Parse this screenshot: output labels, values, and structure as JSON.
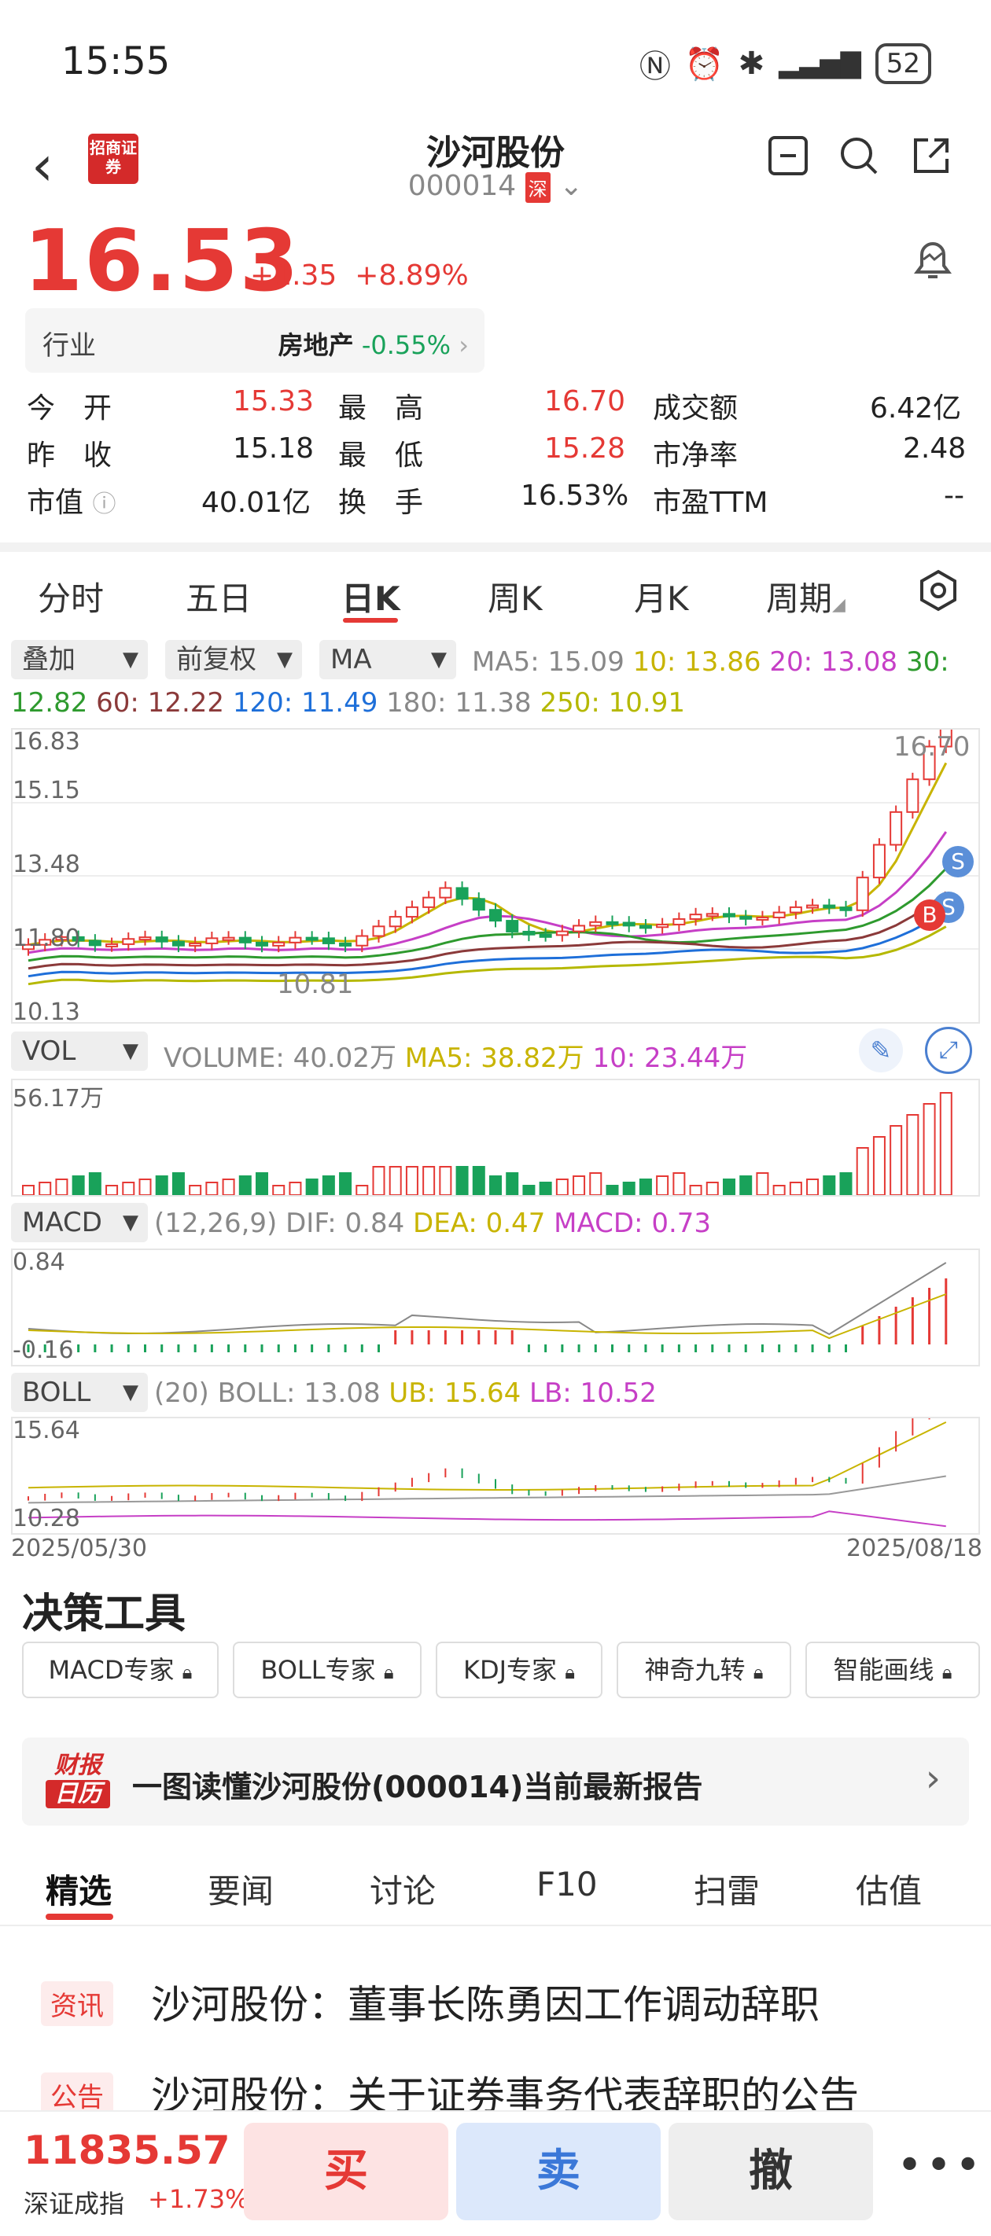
{
  "status_bar": {
    "time": "15:55",
    "battery": "52",
    "icons": [
      "nfc-icon",
      "alarm-icon",
      "bluetooth-icon",
      "signal-icon",
      "battery-icon"
    ]
  },
  "header": {
    "stock_name": "沙河股份",
    "stock_code": "000014",
    "market_tag": "深",
    "logo_text": "招商证券"
  },
  "quote": {
    "price": "16.53",
    "change": "+1.35",
    "change_pct": "+8.89%",
    "industry_label": "行业",
    "industry_name": "房地产",
    "industry_change": "-0.55%",
    "open_label": "今　开",
    "open": "15.33",
    "high_label": "最　高",
    "high": "16.70",
    "amount_label": "成交额",
    "amount": "6.42亿",
    "prev_close_label": "昨　收",
    "prev_close": "15.18",
    "low_label": "最　低",
    "low": "15.28",
    "pb_label": "市净率",
    "pb": "2.48",
    "mktcap_label": "市值",
    "mktcap": "40.01亿",
    "turnover_label": "换　手",
    "turnover": "16.53%",
    "pe_label": "市盈TTM",
    "pe": "--"
  },
  "kline_tabs": [
    "分时",
    "五日",
    "日K",
    "周K",
    "月K",
    "周期"
  ],
  "active_kline_tab": "日K",
  "chips": {
    "overlay": "叠加",
    "adjust": "前复权",
    "indicator": "MA",
    "vol": "VOL",
    "macd": "MACD",
    "boll": "BOLL"
  },
  "ma_legend": {
    "ma5": "MA5: 15.09",
    "ma10": "10: 13.86",
    "ma20": "20: 13.08",
    "ma30": "30:",
    "ma30_val": "12.82",
    "ma60": "60: 12.22",
    "ma120": "120: 11.49",
    "ma180": "180: 11.38",
    "ma250": "250: 10.91"
  },
  "main_axis": {
    "y_labels": [
      "16.83",
      "15.15",
      "13.48",
      "11.80",
      "10.13"
    ],
    "high_marker": "16.70",
    "low_marker": "10.81",
    "bs_markers": [
      "S",
      "S",
      "B"
    ]
  },
  "vol_legend": {
    "volume": "VOLUME: 40.02万",
    "ma5": "MA5: 38.82万",
    "ma10": "10: 23.44万",
    "axis_max": "56.17万"
  },
  "macd_legend": {
    "params": "(12,26,9)",
    "dif": "DIF: 0.84",
    "dea": "DEA: 0.47",
    "macd": "MACD: 0.73",
    "axis_max": "0.84",
    "axis_min": "-0.16"
  },
  "boll_legend": {
    "params": "(20)",
    "boll": "BOLL: 13.08",
    "ub": "UB: 15.64",
    "lb": "LB: 10.52",
    "axis_max": "15.64",
    "axis_min": "10.28"
  },
  "date_range": {
    "start": "2025/05/30",
    "end": "2025/08/18"
  },
  "tools": {
    "title": "决策工具",
    "buttons": [
      "MACD专家",
      "BOLL专家",
      "KDJ专家",
      "神奇九转",
      "智能画线"
    ]
  },
  "report": {
    "badge_top": "财报",
    "badge_bottom": "日历",
    "text": "一图读懂沙河股份(000014)当前最新报告"
  },
  "news_tabs": [
    "精选",
    "要闻",
    "讨论",
    "F10",
    "扫雷",
    "估值"
  ],
  "news": [
    {
      "tag": "资讯",
      "title": "沙河股份：董事长陈勇因工作调动辞职"
    },
    {
      "tag": "公告",
      "title": "沙河股份：关于证券事务代表辞职的公告"
    }
  ],
  "bottom_bar": {
    "index_value": "11835.57",
    "index_name": "深证成指",
    "index_change": "+1.73%",
    "buy": "买",
    "sell": "卖",
    "cancel": "撤",
    "more": "•••"
  },
  "colors": {
    "up": "#e53935",
    "down": "#19a25a",
    "ma5": "#888888",
    "ma10": "#c8b400",
    "ma20": "#c63fc6",
    "ma30": "#2e9a2e",
    "ma60": "#8b3a3a",
    "ma120": "#1e6fd9",
    "ma250": "#b5b800"
  }
}
